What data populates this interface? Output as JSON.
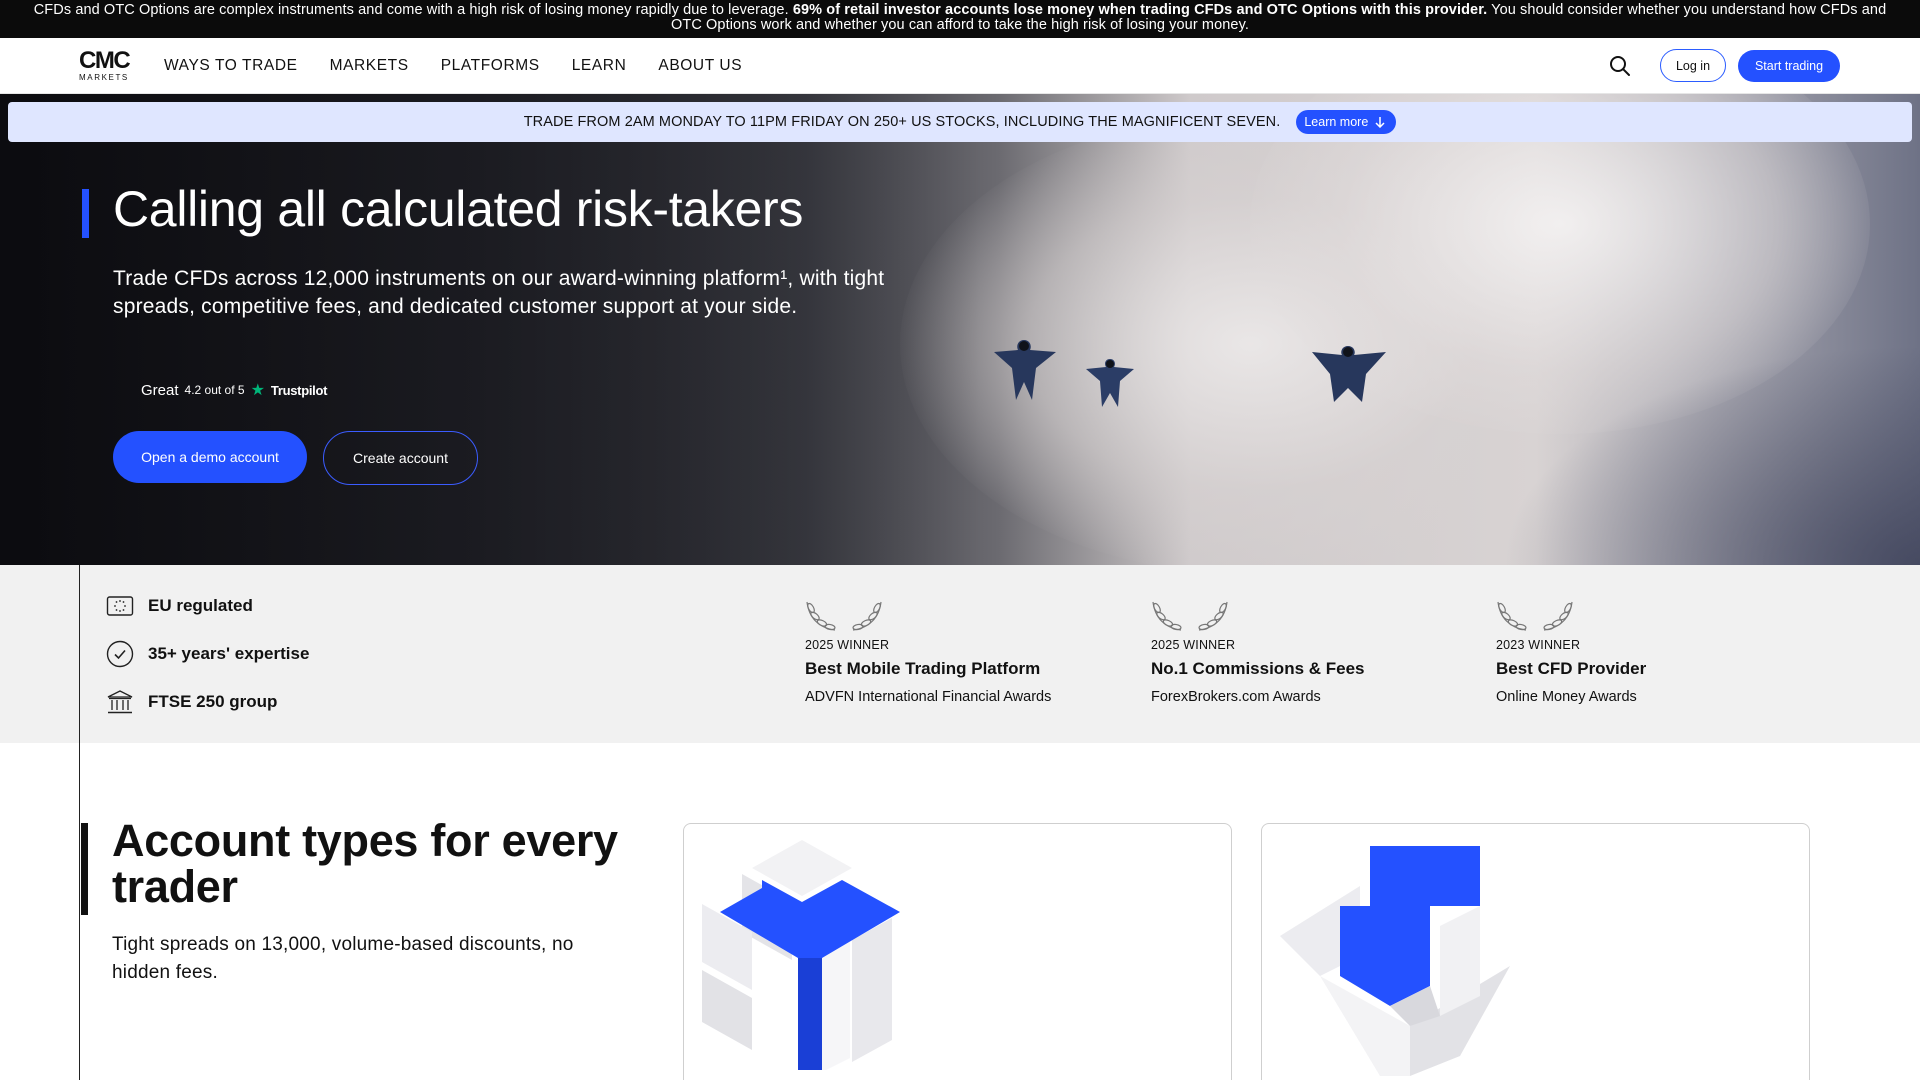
{
  "risk_banner": {
    "lead": "CFDs and OTC Options are complex instruments and come with a high risk of losing money rapidly due to leverage.",
    "bold": "69% of retail investor accounts lose money when trading CFDs and OTC Options with this provider.",
    "tail": "You should consider whether you understand how CFDs and OTC Options work and whether you can afford to take the high risk of losing your money."
  },
  "nav": {
    "logo_mark": "CMC",
    "logo_sub": "MARKETS",
    "links": [
      "WAYS TO TRADE",
      "MARKETS",
      "PLATFORMS",
      "LEARN",
      "ABOUT US"
    ],
    "search_icon": "search-icon",
    "login_label": "Log in",
    "start_label": "Start trading"
  },
  "promo": {
    "text": "TRADE FROM 2AM MONDAY TO 11PM FRIDAY ON 250+ US STOCKS, INCLUDING THE MAGNIFICENT SEVEN.",
    "button": "Learn more",
    "button_icon": "arrow-down-icon"
  },
  "hero": {
    "title": "Calling all calculated risk-takers",
    "description": "Trade CFDs across 12,000 instruments on our award-winning platform¹, with tight spreads, competitive fees, and dedicated customer support at your side.",
    "trustpilot": {
      "rating_word": "Great",
      "score": "4.2 out of 5",
      "brand": "Trustpilot"
    },
    "demo_button": "Open a demo account",
    "create_button": "Create account"
  },
  "features": [
    {
      "icon": "eu-flag-icon",
      "label": "EU regulated"
    },
    {
      "icon": "check-circle-icon",
      "label": "35+ years' expertise"
    },
    {
      "icon": "bank-icon",
      "label": "FTSE 250 group"
    }
  ],
  "awards": [
    {
      "year": "2025 WINNER",
      "title": "Best Mobile Trading Platform",
      "org": "ADVFN International Financial Awards"
    },
    {
      "year": "2025 WINNER",
      "title": "No.1 Commissions & Fees",
      "org": "ForexBrokers.com Awards"
    },
    {
      "year": "2023 WINNER",
      "title": "Best CFD Provider",
      "org": "Online Money Awards"
    }
  ],
  "accounts": {
    "title": "Account types for every trader",
    "description": "Tight spreads on 13,000, volume-based discounts, no hidden fees."
  },
  "colors": {
    "brand_blue": "#2451ff",
    "promo_bg": "#dfe6ff",
    "trustpilot_green": "#00b67a"
  }
}
